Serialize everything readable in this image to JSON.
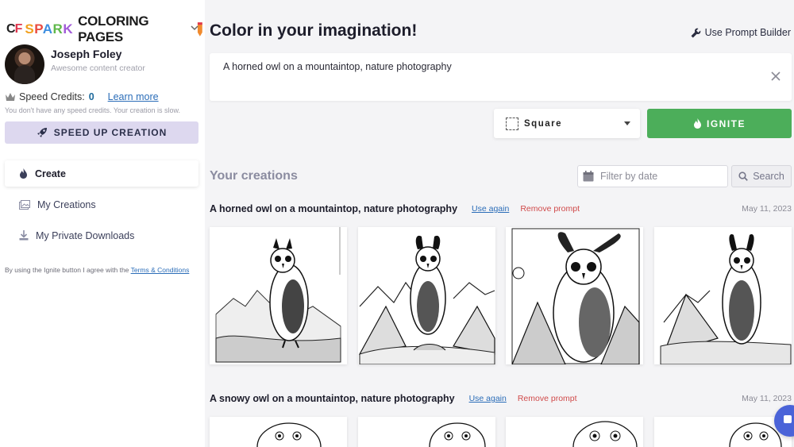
{
  "brand": {
    "mark": "C",
    "mark_b": "F",
    "spark_letters": [
      "S",
      "P",
      "A",
      "R",
      "K"
    ],
    "rest": "COLORING PAGES"
  },
  "profile": {
    "name": "Joseph Foley",
    "role": "Awesome content creator"
  },
  "credits": {
    "label": "Speed Credits:",
    "value": "0",
    "learn_more": "Learn more",
    "note": "You don't have any speed credits. Your creation is slow."
  },
  "speed_button": "SPEED UP CREATION",
  "nav": {
    "create": "Create",
    "my_creations": "My Creations",
    "my_private_downloads": "My Private Downloads"
  },
  "terms": {
    "text": "By using the Ignite button I agree with the ",
    "link": "Terms & Conditions"
  },
  "main": {
    "title": "Color in your imagination!",
    "prompt_builder": "Use Prompt Builder",
    "prompt_value": "A horned owl on a mountaintop, nature photography",
    "shape": "Square",
    "ignite": "IGNITE"
  },
  "creations": {
    "title": "Your creations",
    "filter_placeholder": "Filter by date",
    "search": "Search",
    "groups": [
      {
        "prompt": "A horned owl on a mountaintop, nature photography",
        "use_again": "Use again",
        "remove": "Remove prompt",
        "date": "May 11, 2023"
      },
      {
        "prompt": "A snowy owl on a mountaintop, nature photography",
        "use_again": "Use again",
        "remove": "Remove prompt",
        "date": "May 11, 2023"
      }
    ]
  },
  "colors": {
    "ignite": "#4cae5a",
    "speed_button_bg": "#ddd8ef",
    "link": "#2b6db8",
    "remove": "#d04a4a"
  }
}
